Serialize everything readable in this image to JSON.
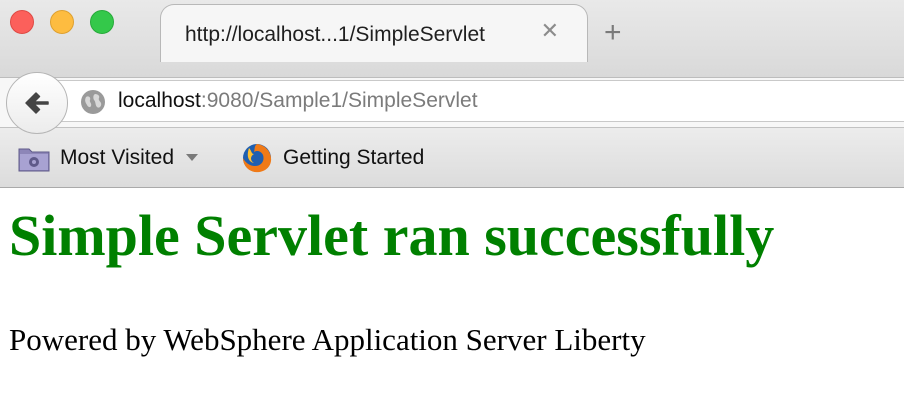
{
  "window": {
    "controls": [
      "close",
      "minimize",
      "maximize"
    ]
  },
  "tab": {
    "title": "http://localhost...1/SimpleServlet",
    "close_glyph": "✕",
    "new_tab_glyph": "+"
  },
  "navbar": {
    "url_host": "localhost",
    "url_rest": ":9080/Sample1/SimpleServlet",
    "back_icon": "back-arrow-icon",
    "site_icon": "globe-icon"
  },
  "bookmarks": {
    "items": [
      {
        "label": "Most Visited",
        "icon": "folder-icon",
        "has_dropdown": true
      },
      {
        "label": "Getting Started",
        "icon": "firefox-icon",
        "has_dropdown": false
      }
    ]
  },
  "page": {
    "heading": "Simple Servlet ran successfully",
    "footer_text": "Powered by WebSphere Application Server Liberty",
    "heading_color": "#008000"
  }
}
